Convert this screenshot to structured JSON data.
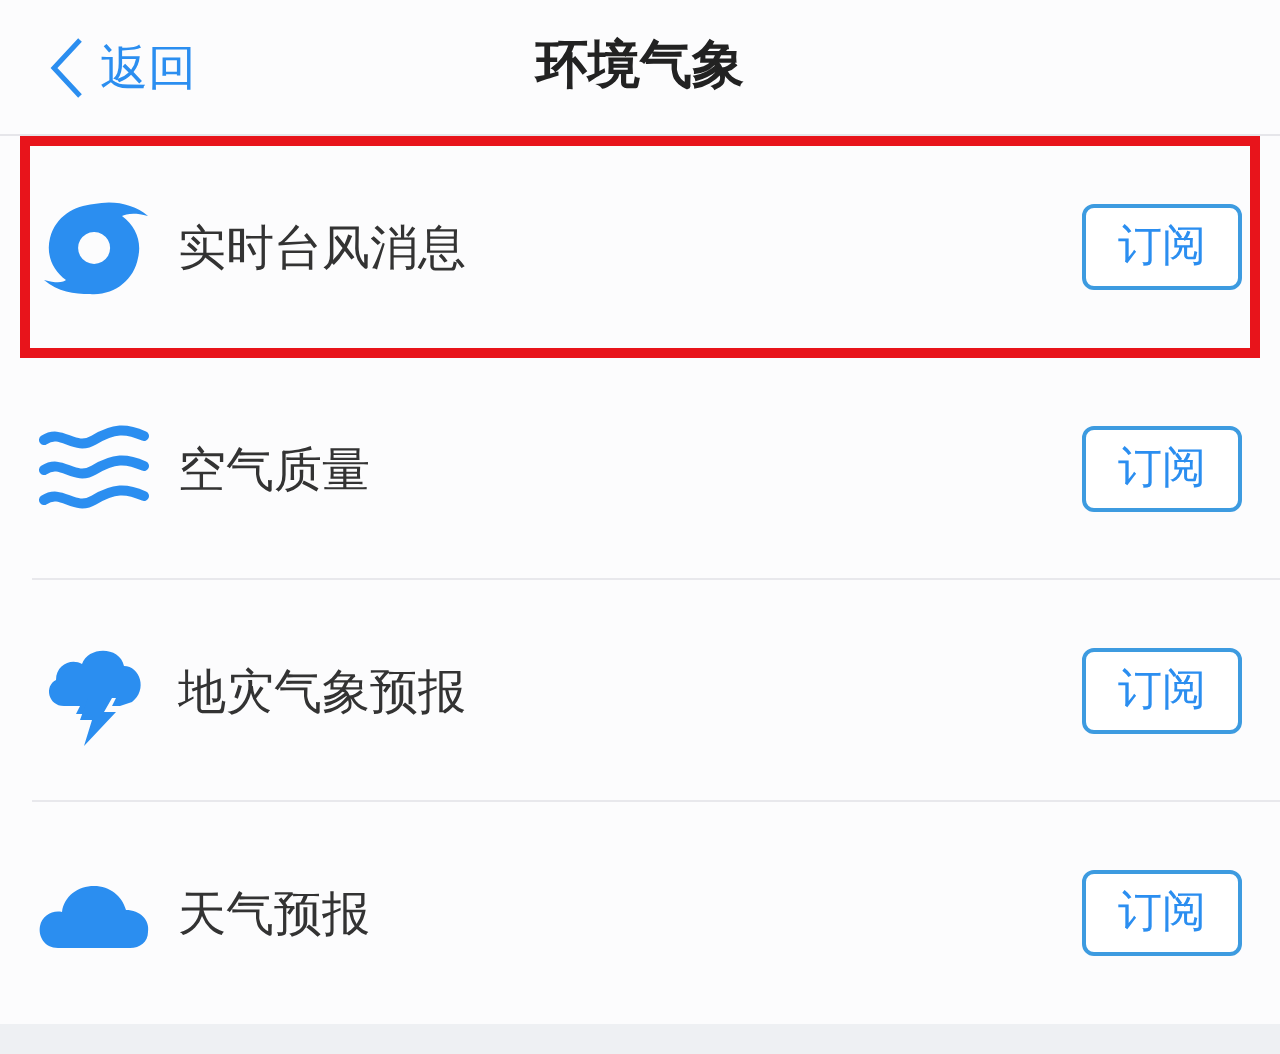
{
  "nav_bar": {
    "back": "返回",
    "title": "环境气象"
  },
  "items": [
    {
      "kind": "typhoon",
      "label": "实时台风消息",
      "button": "订阅",
      "highlighted": true
    },
    {
      "kind": "waves",
      "label": "空气质量",
      "button": "订阅",
      "highlighted": false
    },
    {
      "kind": "storm",
      "label": "地灾气象预报",
      "button": "订阅",
      "highlighted": false
    },
    {
      "kind": "cloud",
      "label": "天气预报",
      "button": "订阅",
      "highlighted": false
    }
  ]
}
